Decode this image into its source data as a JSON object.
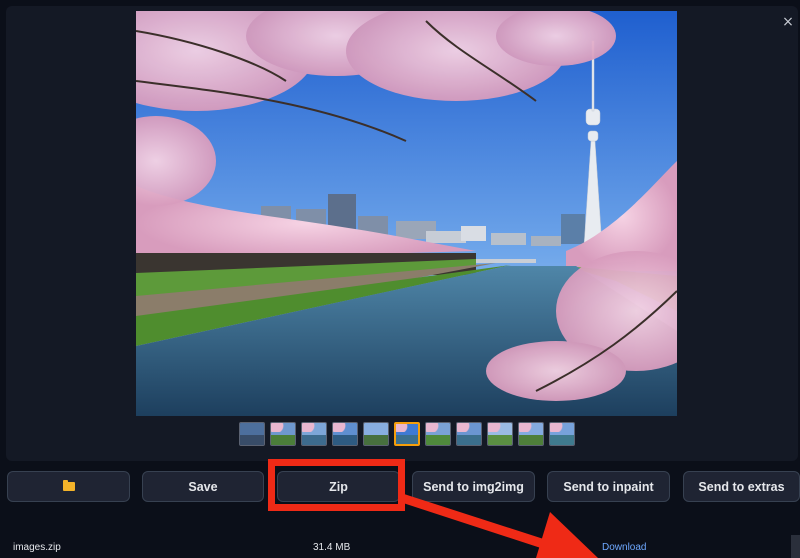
{
  "gallery": {
    "close_symbol": "×",
    "selected_index": 5,
    "thumbnail_count": 11
  },
  "actions": {
    "folder_icon": "folder-icon",
    "save_label": "Save",
    "zip_label": "Zip",
    "send_img2img_label": "Send to img2img",
    "send_inpaint_label": "Send to inpaint",
    "send_extras_label": "Send to extras"
  },
  "file": {
    "name": "images.zip",
    "size": "31.4 MB",
    "download_label": "Download"
  },
  "colors": {
    "background": "#0b0f19",
    "panel": "#141925",
    "button": "#1f2433",
    "highlight": "#ef2a16",
    "link": "#6ea8ff",
    "folder": "#f3b32a",
    "selected_thumb": "#f59e0b"
  }
}
